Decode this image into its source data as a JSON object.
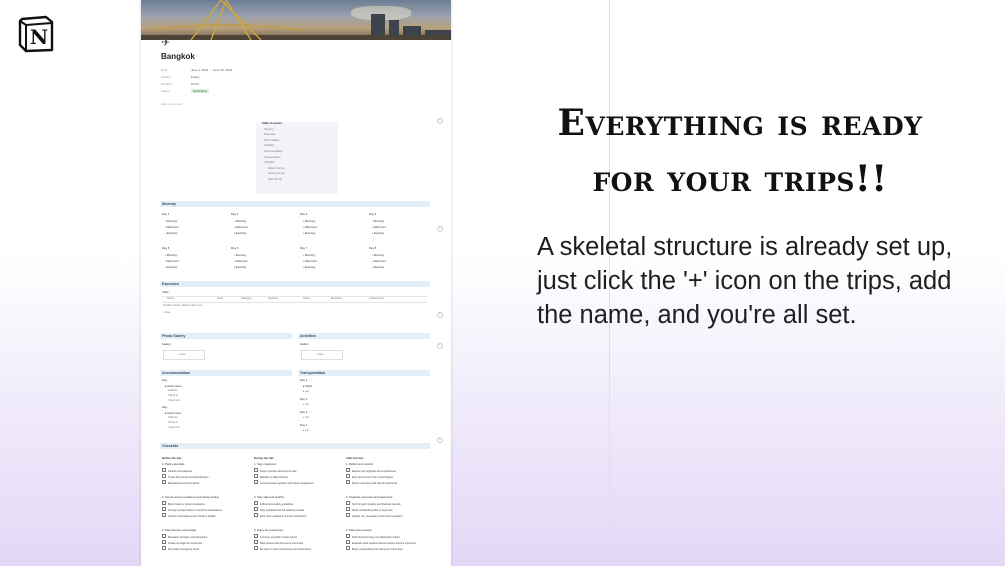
{
  "page": {
    "heading_line1": "Everything is ready",
    "heading_line2": "for your trips!!",
    "body": "A skeletal structure is already set up, just click the '+' icon on the trips, add the name, and you're all set."
  },
  "logo": {
    "letter": "N"
  },
  "doc": {
    "page_icon": "✈",
    "title": "Bangkok",
    "props": [
      {
        "k": "Date",
        "v": "June 1, 2024 → June 15, 2024"
      },
      {
        "k": "Activity",
        "v": "Empty"
      },
      {
        "k": "Duration",
        "v": "15.00"
      },
      {
        "k": "Status",
        "v": "Upcoming"
      }
    ],
    "add_comment": "Add a comment...",
    "toc_title": "Table of content",
    "toc": [
      "Itinerary",
      "Expenses",
      "Photo Gallery",
      "Activities",
      "Accommodation",
      "Transportation",
      "Checklist",
      "Before the trip",
      "During the trip",
      "After the trip"
    ],
    "itinerary": {
      "title": "Itinerary",
      "days": [
        "Day 1",
        "Day 2",
        "Day 3",
        "Day 4",
        "Day 5",
        "Day 6",
        "Day 7",
        "Day 8"
      ],
      "items": [
        "Morning:",
        "Afternoon:",
        "Evening:"
      ]
    },
    "expenses": {
      "title": "Expenses",
      "view": "Table",
      "cols": [
        "Name",
        "Price",
        "Category",
        "Expense",
        "Notes",
        "Merchant",
        "Created time"
      ],
      "empty": "No filter results. Click to add a row",
      "new": "+ New"
    },
    "gallery": {
      "title": "Photo Gallery",
      "view": "Gallery",
      "new": "+ New"
    },
    "activities": {
      "title": "Activities",
      "view": "Gallery",
      "new": "+ New"
    },
    "accommodation": {
      "title": "Accommodation",
      "day1": "Day:",
      "items": [
        "Hotel name",
        "Address",
        "Check in",
        "Check out"
      ],
      "day2": "Day:"
    },
    "transportation": {
      "title": "Transportation",
      "days": [
        "Day 1",
        "Day 2",
        "Day 3",
        "Day 4"
      ],
      "first_item": "Flight",
      "list": "List"
    },
    "checklist": {
      "title": "Checklist",
      "cols": [
        {
          "title": "Before the trip:",
          "groups": [
            {
              "name": "1. Pack essentials",
              "items": [
                "Clothes and toiletries",
                "Travel documents and identification",
                "Medications and first aid kit"
              ]
            },
            {
              "name": "2. Secure accommodations and transportation",
              "items": [
                "Book hotels or accommodations",
                "Arrange transportation to and from destinations",
                "Confirm reservations and check-in details"
              ]
            },
            {
              "name": "3. Plan itinerary and budget",
              "items": [
                "Research activities and attractions",
                "Create a budget for expenses",
                "Set aside emergency funds"
              ]
            }
          ]
        },
        {
          "title": "During the trip:",
          "groups": [
            {
              "name": "1. Stay organized",
              "items": [
                "Keep important documents safe",
                "Maintain a daily itinerary",
                "Communicate regularly with travel companions"
              ]
            },
            {
              "name": "2. Stay safe and healthy",
              "items": [
                "Follow local safety guidelines",
                "Stay hydrated and eat balanced meals",
                "Rest often needed to prevent exhaustion"
              ]
            },
            {
              "name": "3. Enjoy the experience",
              "items": [
                "Immerse yourself in local culture",
                "Take photos and document memories",
                "Be open to new experiences and adventures"
              ]
            }
          ]
        },
        {
          "title": "After the trip:",
          "groups": [
            {
              "name": "1. Reflect and unwind",
              "items": [
                "Review trip highlights and experiences",
                "Rest and recover from travel fatigue",
                "Share memories with friends and family"
              ]
            },
            {
              "name": "2. Organize expenses and paperwork",
              "items": [
                "Sort through receipts and financial records",
                "Settle outstanding bills or expenses",
                "Update any necessary travel documentation"
              ]
            },
            {
              "name": "3. Plan future travels",
              "items": [
                "Start brainstorming next destination ideas",
                "Evaluate what worked well and what could be improved",
                "Begin researching and saving for future trips"
              ]
            }
          ]
        }
      ]
    }
  }
}
